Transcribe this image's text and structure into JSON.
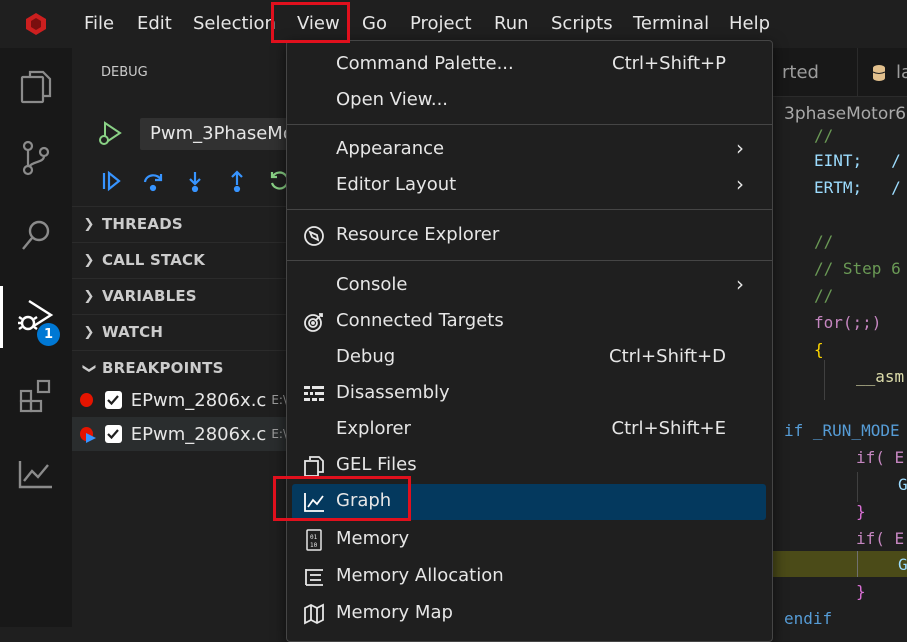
{
  "menubar": {
    "items": [
      "File",
      "Edit",
      "Selection",
      "View",
      "Go",
      "Project",
      "Run",
      "Scripts",
      "Terminal",
      "Help"
    ]
  },
  "activity": {
    "icons": [
      "explorer-icon",
      "source-control-icon",
      "search-icon",
      "debug-icon",
      "extensions-icon",
      "graph-icon"
    ],
    "debug_badge": "1"
  },
  "sidebar": {
    "title": "DEBUG",
    "config_name": "Pwm_3PhaseMo",
    "sections": [
      "THREADS",
      "CALL STACK",
      "VARIABLES",
      "WATCH",
      "BREAKPOINTS"
    ],
    "breakpoints": [
      {
        "file": "EPwm_2806x.c",
        "path": "E:\\"
      },
      {
        "file": "EPwm_2806x.c",
        "path": "E:\\"
      }
    ]
  },
  "editor": {
    "tabs": [
      {
        "label": "rted"
      },
      {
        "label": "la"
      }
    ],
    "breadcrumb": "3phaseMotor6",
    "lines": [
      {
        "text": "//",
        "color": "#6a9955"
      },
      {
        "text": "EINT;   /",
        "color": "#9cdcfe"
      },
      {
        "text": "ERTM;   /",
        "color": "#9cdcfe"
      },
      {
        "text": "//",
        "color": "#6a9955"
      },
      {
        "text": "// Step 6",
        "color": "#6a9955"
      },
      {
        "text": "//",
        "color": "#6a9955"
      },
      {
        "text": "for(;;)",
        "color": "#c586c0"
      },
      {
        "text": "{",
        "color": "#ffd700"
      },
      {
        "text": "__asm",
        "color": "#dcdcaa"
      },
      {
        "text": "if _RUN_MODE",
        "color": "#569cd6"
      },
      {
        "text": "if( E",
        "color": "#c586c0"
      },
      {
        "text": "G",
        "color": "#9cdcfe"
      },
      {
        "text": "}",
        "color": "#da70d6"
      },
      {
        "text": "if( E",
        "color": "#c586c0"
      },
      {
        "text": "G",
        "color": "#9cdcfe"
      },
      {
        "text": "}",
        "color": "#da70d6"
      },
      {
        "text": "endif",
        "color": "#569cd6"
      }
    ]
  },
  "view_menu": {
    "items": [
      {
        "label": "Command Palette...",
        "shortcut": "Ctrl+Shift+P",
        "icon": ""
      },
      {
        "label": "Open View...",
        "shortcut": "",
        "icon": ""
      },
      {
        "label": "Appearance",
        "shortcut": "",
        "icon": "",
        "submenu": "›"
      },
      {
        "label": "Editor Layout",
        "shortcut": "",
        "icon": "",
        "submenu": "›"
      },
      {
        "label": "Resource Explorer",
        "shortcut": "",
        "icon": "compass-icon"
      },
      {
        "label": "Console",
        "shortcut": "",
        "icon": "",
        "submenu": "›"
      },
      {
        "label": "Connected Targets",
        "shortcut": "",
        "icon": "target-icon"
      },
      {
        "label": "Debug",
        "shortcut": "Ctrl+Shift+D",
        "icon": ""
      },
      {
        "label": "Disassembly",
        "shortcut": "",
        "icon": "disassembly-icon"
      },
      {
        "label": "Explorer",
        "shortcut": "Ctrl+Shift+E",
        "icon": ""
      },
      {
        "label": "GEL Files",
        "shortcut": "",
        "icon": "files-icon"
      },
      {
        "label": "Graph",
        "shortcut": "",
        "icon": "graph-icon",
        "active": true
      },
      {
        "label": "Memory",
        "shortcut": "",
        "icon": "memory-icon"
      },
      {
        "label": "Memory Allocation",
        "shortcut": "",
        "icon": "memory-allocation-icon"
      },
      {
        "label": "Memory Map",
        "shortcut": "",
        "icon": "map-icon"
      }
    ]
  },
  "colors": {
    "highlight_box": "#e0101d",
    "menu_active_bg": "#04395e",
    "breakpoint_red": "#e51400",
    "accent_blue": "#0078d4"
  }
}
